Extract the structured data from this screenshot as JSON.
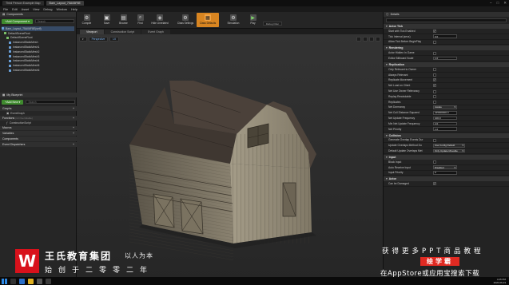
{
  "titlebar": {
    "doc_tabs": [
      "Third Person Example Map",
      "Barn_Layout_75A06F8E"
    ],
    "window_controls": [
      "–",
      "□",
      "✕"
    ]
  },
  "menu": [
    "File",
    "Edit",
    "Asset",
    "View",
    "Debug",
    "Window",
    "Help"
  ],
  "components_panel": {
    "title": "Components",
    "add_button": "+Add Component ▾",
    "search_placeholder": "Search",
    "self_item": "Barn_Layout_75A06F8E(self)",
    "tree": [
      "DefaultSceneRoot",
      "DefaultSceneRoot",
      "InstancedStaticMesh",
      "InstancedStaticMesh1",
      "InstancedStaticMesh2",
      "InstancedStaticMesh3",
      "InstancedStaticMesh4",
      "InstancedStaticMesh5",
      "InstancedStaticMesh6"
    ]
  },
  "my_blueprint": {
    "title": "My Blueprint",
    "add_button": "+Add New ▾",
    "search_placeholder": "Search",
    "sections": {
      "graphs": "Graphs",
      "event_graph": "EventGraph",
      "functions": "Functions",
      "functions_count": "(13 Overridable)",
      "construction_script": "ConstructionScript",
      "macros": "Macros",
      "variables": "Variables",
      "components": "Components",
      "event_dispatchers": "Event Dispatchers"
    }
  },
  "toolbar": {
    "buttons": [
      {
        "label": "Compile",
        "icon": "⚙"
      },
      {
        "label": "Save",
        "icon": "▣"
      },
      {
        "label": "Browse",
        "icon": "▤"
      },
      {
        "label": "Find",
        "icon": "⌕"
      },
      {
        "label": "Hide Unrelated",
        "icon": "◈"
      },
      {
        "label": "Class Settings",
        "icon": "⚙"
      },
      {
        "label": "Class Defaults",
        "icon": "▦"
      },
      {
        "label": "Simulation",
        "icon": "⚙"
      },
      {
        "label": "Play",
        "icon": "▶"
      }
    ],
    "debug_filter": "Debug Filter"
  },
  "editor_tabs": [
    "Viewport",
    "Construction Script",
    "Event Graph"
  ],
  "viewport": {
    "view_mode": "Perspective",
    "lit_mode": "Lit"
  },
  "details": {
    "title": "Details",
    "categories": [
      {
        "name": "Actor Tick",
        "rows": [
          {
            "label": "Start with Tick Enabled",
            "type": "check",
            "value": "✓"
          },
          {
            "label": "Tick Interval (secs)",
            "type": "num",
            "value": "0.0"
          },
          {
            "label": "Allow Tick Before BeginPlay",
            "type": "check",
            "value": ""
          }
        ]
      },
      {
        "name": "Rendering",
        "rows": [
          {
            "label": "Actor Hidden In Game",
            "type": "check",
            "value": ""
          },
          {
            "label": "Editor Billboard Scale",
            "type": "num",
            "value": "1.0"
          }
        ]
      },
      {
        "name": "Replication",
        "rows": [
          {
            "label": "Only Relevant to Owner",
            "type": "check",
            "value": ""
          },
          {
            "label": "Always Relevant",
            "type": "check",
            "value": ""
          },
          {
            "label": "Replicate Movement",
            "type": "check",
            "value": "✓"
          },
          {
            "label": "Net Load on Client",
            "type": "check",
            "value": "✓"
          },
          {
            "label": "Net Use Owner Relevancy",
            "type": "check",
            "value": ""
          },
          {
            "label": "Replay Rewindable",
            "type": "check",
            "value": ""
          },
          {
            "label": "Replicates",
            "type": "check",
            "value": ""
          },
          {
            "label": "Net Dormancy",
            "type": "drop",
            "value": "Awake"
          },
          {
            "label": "Net Cull Distance Squared",
            "type": "num",
            "value": "225000000.0"
          },
          {
            "label": "Net Update Frequency",
            "type": "num",
            "value": "100.0"
          },
          {
            "label": "Min Net Update Frequency",
            "type": "num",
            "value": "2.0"
          },
          {
            "label": "Net Priority",
            "type": "num",
            "value": "1.0"
          }
        ]
      },
      {
        "name": "Collision",
        "rows": [
          {
            "label": "Generate Overlap Events Dur",
            "type": "check",
            "value": ""
          },
          {
            "label": "Update Overlaps Method Du",
            "type": "dropw",
            "value": "Use Config Default"
          },
          {
            "label": "Default Update Overlaps Met",
            "type": "dropw",
            "value": "Only Update Movable"
          }
        ]
      },
      {
        "name": "Input",
        "rows": [
          {
            "label": "Block Input",
            "type": "check",
            "value": ""
          },
          {
            "label": "Auto Receive Input",
            "type": "drop",
            "value": "Disabled"
          },
          {
            "label": "Input Priority",
            "type": "num",
            "value": "0"
          }
        ]
      },
      {
        "name": "Actor",
        "rows": [
          {
            "label": "Can be Damaged",
            "type": "check",
            "value": "✓"
          }
        ]
      }
    ]
  },
  "taskbar": {
    "time": "4:25 PM",
    "date": "2020-06-23"
  },
  "watermark": {
    "logo_letter": "W",
    "org_name": "王氏教育集团",
    "slogan": "以人为本",
    "founded": "始创于二零零二年",
    "more_line": "获得更多PPT商品教程",
    "brand": "绘学霸",
    "store_line": "在AppStore或应用宝搜索下载"
  },
  "colors": {
    "accent_orange": "#d88521",
    "selection_blue": "#364a66",
    "add_green": "#3f8a2e",
    "watermark_red": "#d8111b"
  }
}
